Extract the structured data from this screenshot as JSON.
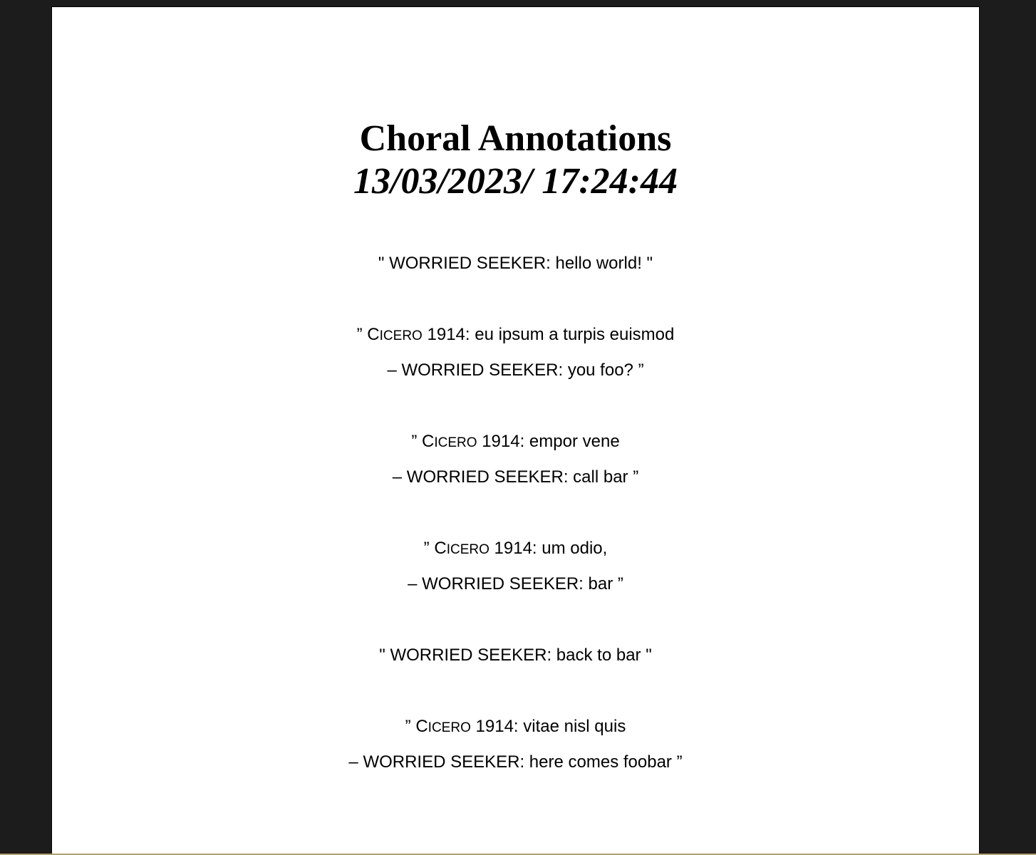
{
  "document": {
    "title": "Choral Annotations",
    "datetime": "13/03/2023/ 17:24:44"
  },
  "lines": [
    {
      "open": "\" ",
      "speaker_cap": "",
      "speaker_rest": "",
      "text": "WORRIED SEEKER: hello world! \""
    },
    {
      "open": "” ",
      "speaker_cap": "C",
      "speaker_rest": "ICERO",
      "text": " 1914: eu ipsum a turpis euismod"
    },
    {
      "open": "",
      "speaker_cap": "",
      "speaker_rest": "",
      "text": "– WORRIED SEEKER: you foo? ”"
    },
    {
      "open": "” ",
      "speaker_cap": "C",
      "speaker_rest": "ICERO",
      "text": " 1914: empor vene"
    },
    {
      "open": "",
      "speaker_cap": "",
      "speaker_rest": "",
      "text": "– WORRIED SEEKER: call bar ”"
    },
    {
      "open": "” ",
      "speaker_cap": "C",
      "speaker_rest": "ICERO",
      "text": " 1914: um odio,"
    },
    {
      "open": "",
      "speaker_cap": "",
      "speaker_rest": "",
      "text": "– WORRIED SEEKER: bar ”"
    },
    {
      "open": "\" ",
      "speaker_cap": "",
      "speaker_rest": "",
      "text": "WORRIED SEEKER: back to bar \""
    },
    {
      "open": "” ",
      "speaker_cap": "C",
      "speaker_rest": "ICERO",
      "text": " 1914: vitae nisl quis"
    },
    {
      "open": "",
      "speaker_cap": "",
      "speaker_rest": "",
      "text": "– WORRIED SEEKER: here comes foobar ”"
    }
  ]
}
